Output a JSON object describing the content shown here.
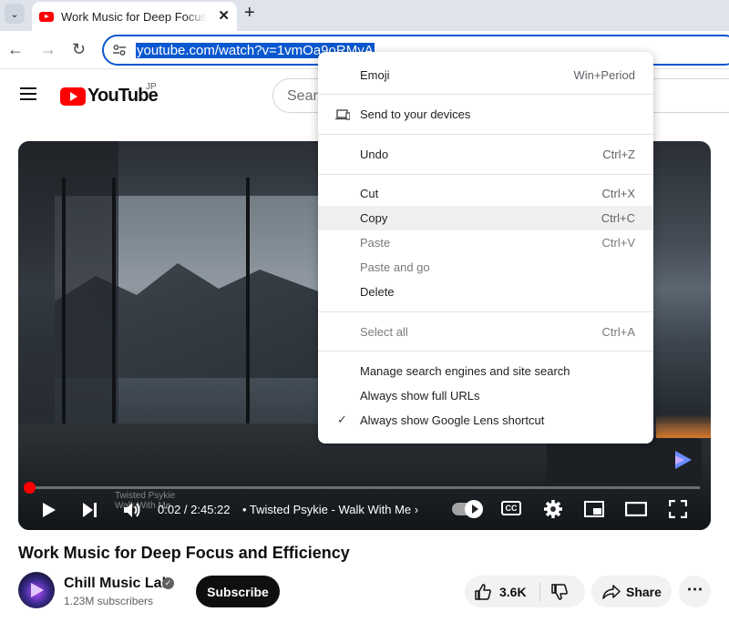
{
  "browser": {
    "tab": {
      "title": "Work Music for Deep Focus and Efficiency - YouTube",
      "close_glyph": "✕"
    },
    "tab_menu_glyph": "⌄",
    "new_tab_glyph": "+",
    "back_glyph": "←",
    "forward_glyph": "→",
    "reload_glyph": "↻",
    "url": "youtube.com/watch?v=1vmOa9oRMyA"
  },
  "youtube": {
    "logo_text": "YouTube",
    "region": "JP",
    "search_placeholder": "Search"
  },
  "player": {
    "progress": 0.0002,
    "time": "0:02 / 2:45:22",
    "chapter_label": "• Twisted Psykie - Walk With Me",
    "chapter_chevron": "›",
    "thumbnail_ghost_line1": "Twisted Psykie",
    "thumbnail_ghost_line2": "Walk With Me",
    "cc_label": "CC"
  },
  "video": {
    "title": "Work Music for Deep Focus and Efficiency",
    "channel": "Chill Music Lab",
    "verified_glyph": "✓",
    "subscribers": "1.23M subscribers",
    "subscribe_label": "Subscribe",
    "likes": "3.6K",
    "share_label": "Share",
    "more_glyph": "⋯"
  },
  "context_menu": {
    "emoji": {
      "label": "Emoji",
      "shortcut": "Win+Period"
    },
    "send": {
      "label": "Send to your devices"
    },
    "undo": {
      "label": "Undo",
      "shortcut": "Ctrl+Z"
    },
    "cut": {
      "label": "Cut",
      "shortcut": "Ctrl+X"
    },
    "copy": {
      "label": "Copy",
      "shortcut": "Ctrl+C"
    },
    "paste": {
      "label": "Paste",
      "shortcut": "Ctrl+V"
    },
    "paste_and_go": {
      "label": "Paste and go"
    },
    "delete": {
      "label": "Delete"
    },
    "select_all": {
      "label": "Select all",
      "shortcut": "Ctrl+A"
    },
    "manage_search": {
      "label": "Manage search engines and site search"
    },
    "full_urls": {
      "label": "Always show full URLs"
    },
    "lens": {
      "label": "Always show Google Lens shortcut",
      "check_glyph": "✓"
    }
  },
  "colors": {
    "accent_blue": "#0b57d0",
    "youtube_red": "#ff0000",
    "subscribe_bg": "#0f0f0f"
  }
}
